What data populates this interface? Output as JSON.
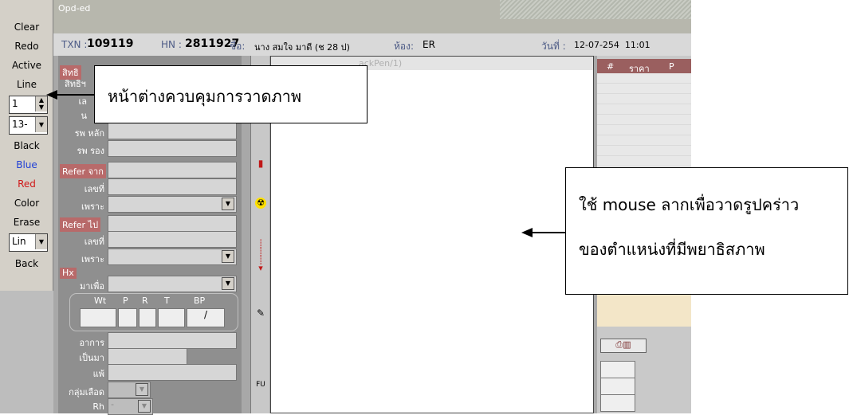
{
  "palette": {
    "clear": "Clear",
    "redo": "Redo",
    "active": "Active",
    "line": "Line",
    "width_value": "1",
    "size_value": "13-",
    "black": "Black",
    "blue": "Blue",
    "red": "Red",
    "color": "Color",
    "erase": "Erase",
    "linetype_value": "Lin",
    "back": "Back"
  },
  "window": {
    "title": "Opd-ed",
    "txn_label": "TXN :",
    "txn_value": "109119",
    "hn_label": "HN :",
    "hn_value": "2811927",
    "name_label": "ชื่อ:",
    "name_value": "นาง สมใจ มาดี  (ช 28 ป)",
    "room_label": "ห้อง:",
    "room_value": "ER",
    "date_label": "วันที่ :",
    "date_value": "12-07-254  11:01"
  },
  "form": {
    "rights_header": "สิทธิ",
    "rights_label": "สิทธิฯ",
    "rights_num_label": "เล",
    "rights_sub_label": "น",
    "main_hosp_label": "รพ หลัก",
    "sub_hosp_label": "รพ รอง",
    "refer_from_header": "Refer จาก",
    "refer_from_no_label": "เลขที่",
    "refer_from_reason_label": "เพราะ",
    "refer_to_header": "Refer ไป",
    "refer_to_no_label": "เลขที่",
    "refer_to_reason_label": "เพราะ",
    "hx_header": "Hx",
    "came_for_label": "มาเพื่อ",
    "vitals_labels": [
      "Wt",
      "P",
      "R",
      "T",
      "BP"
    ],
    "bp_value": "/",
    "symptom_label": "อาการ",
    "since_label": "เป็นมา",
    "allergy_label": "แพ้",
    "blood_group_label": "กลุ่มเลือด",
    "rh_label": "Rh",
    "rh_value": "-"
  },
  "canvas": {
    "caption": "ackPen/1)"
  },
  "strip": {
    "fu_label": "FU"
  },
  "rpanel": {
    "col_hash": "#",
    "col_price": "ราคา",
    "col_p": "P"
  },
  "annotations": {
    "control_window": "หน้าต่างควบคุมการวาดภาพ",
    "drag_line1": "ใช้ mouse ลากเพื่อวาดรูปคร่าว",
    "drag_line2": "ของตำแหน่งที่มีพยาธิสภาพ"
  }
}
